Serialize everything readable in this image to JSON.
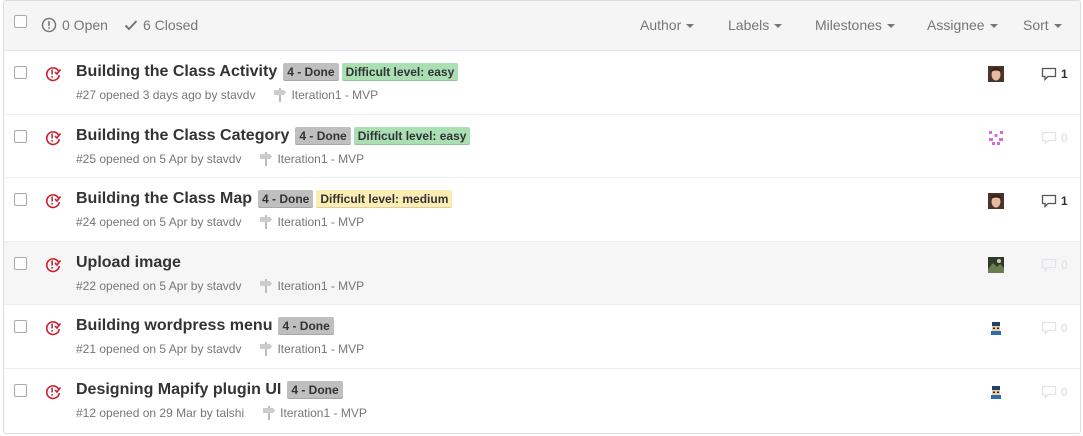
{
  "header": {
    "open_label": "0 Open",
    "closed_label": "6 Closed",
    "filters": {
      "author": "Author",
      "labels": "Labels",
      "milestones": "Milestones",
      "assignee": "Assignee",
      "sort": "Sort"
    }
  },
  "colors": {
    "label_done": "#bfbfbf",
    "label_easy": "#a9dfb3",
    "label_medium": "#fbedb4",
    "closed_icon": "#cb2431"
  },
  "issues": [
    {
      "title": "Building the Class Activity",
      "labels": [
        "4 - Done",
        "Difficult level: easy"
      ],
      "meta": "#27 opened 3 days ago by stavdv",
      "milestone": "Iteration1 - MVP",
      "comments": "1",
      "avatar": "avatar-photo"
    },
    {
      "title": "Building the Class Category",
      "labels": [
        "4 - Done",
        "Difficult level: easy"
      ],
      "meta": "#25 opened on 5 Apr by stavdv",
      "milestone": "Iteration1 - MVP",
      "comments": "0",
      "avatar": "avatar-identicon"
    },
    {
      "title": "Building the Class Map",
      "labels": [
        "4 - Done",
        "Difficult level: medium"
      ],
      "meta": "#24 opened on 5 Apr by stavdv",
      "milestone": "Iteration1 - MVP",
      "comments": "1",
      "avatar": "avatar-photo"
    },
    {
      "title": "Upload image",
      "labels": [],
      "meta": "#22 opened on 5 Apr by stavdv",
      "milestone": "Iteration1 - MVP",
      "comments": "0",
      "avatar": "avatar-landscape"
    },
    {
      "title": "Building wordpress menu",
      "labels": [
        "4 - Done"
      ],
      "meta": "#21 opened on 5 Apr by stavdv",
      "milestone": "Iteration1 - MVP",
      "comments": "0",
      "avatar": "avatar-cartoon"
    },
    {
      "title": "Designing Mapify plugin UI",
      "labels": [
        "4 - Done"
      ],
      "meta": "#12 opened on 29 Mar by talshi",
      "milestone": "Iteration1 - MVP",
      "comments": "0",
      "avatar": "avatar-cartoon"
    }
  ]
}
